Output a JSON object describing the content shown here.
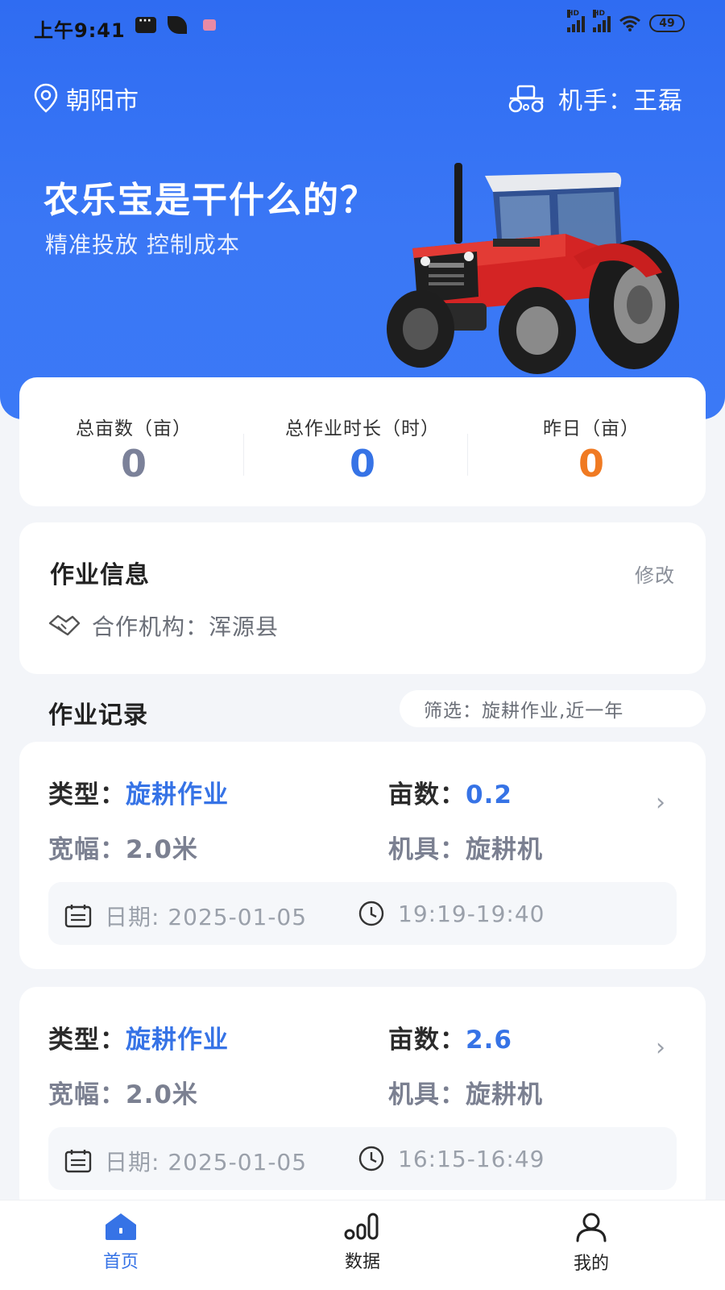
{
  "status_bar": {
    "time": "上午9:41",
    "battery": "49",
    "hd": "HD"
  },
  "header": {
    "city": "朝阳市",
    "operator": "机手：王磊"
  },
  "hero": {
    "title": "农乐宝是干什么的？",
    "subtitle": "精准投放 控制成本"
  },
  "stats": [
    {
      "label": "总亩数（亩）",
      "value": "0",
      "color": "#7b8199"
    },
    {
      "label": "总作业时长（时）",
      "value": "0",
      "color": "#3673e6"
    },
    {
      "label": "昨日（亩）",
      "value": "0",
      "color": "#f07a22"
    }
  ],
  "work_info": {
    "title": "作业信息",
    "edit": "修改",
    "org": "合作机构：浑源县"
  },
  "records": {
    "title": "作业记录",
    "filter": "筛选：旋耕作业,近一年",
    "items": [
      {
        "type_label": "类型：",
        "type_value": "旋耕作业",
        "area_label": "亩数：",
        "area_value": "0.2",
        "width_label": "宽幅：",
        "width_value": "2.0米",
        "tool_label": "机具：",
        "tool_value": "旋耕机",
        "date": "日期: 2025-01-05",
        "time": "19:19-19:40"
      },
      {
        "type_label": "类型：",
        "type_value": "旋耕作业",
        "area_label": "亩数：",
        "area_value": "2.6",
        "width_label": "宽幅：",
        "width_value": "2.0米",
        "tool_label": "机具：",
        "tool_value": "旋耕机",
        "date": "日期: 2025-01-05",
        "time": "16:15-16:49"
      }
    ]
  },
  "tabs": [
    {
      "label": "首页",
      "icon": "home-icon",
      "active": true,
      "color": "#3673e6"
    },
    {
      "label": "数据",
      "icon": "bar-chart-icon",
      "active": false,
      "color": "#222222"
    },
    {
      "label": "我的",
      "icon": "user-icon",
      "active": false,
      "color": "#222222"
    }
  ],
  "colors": {
    "brand": "#3b79f6",
    "accent_blue": "#3673e6",
    "accent_orange": "#f07a22"
  }
}
